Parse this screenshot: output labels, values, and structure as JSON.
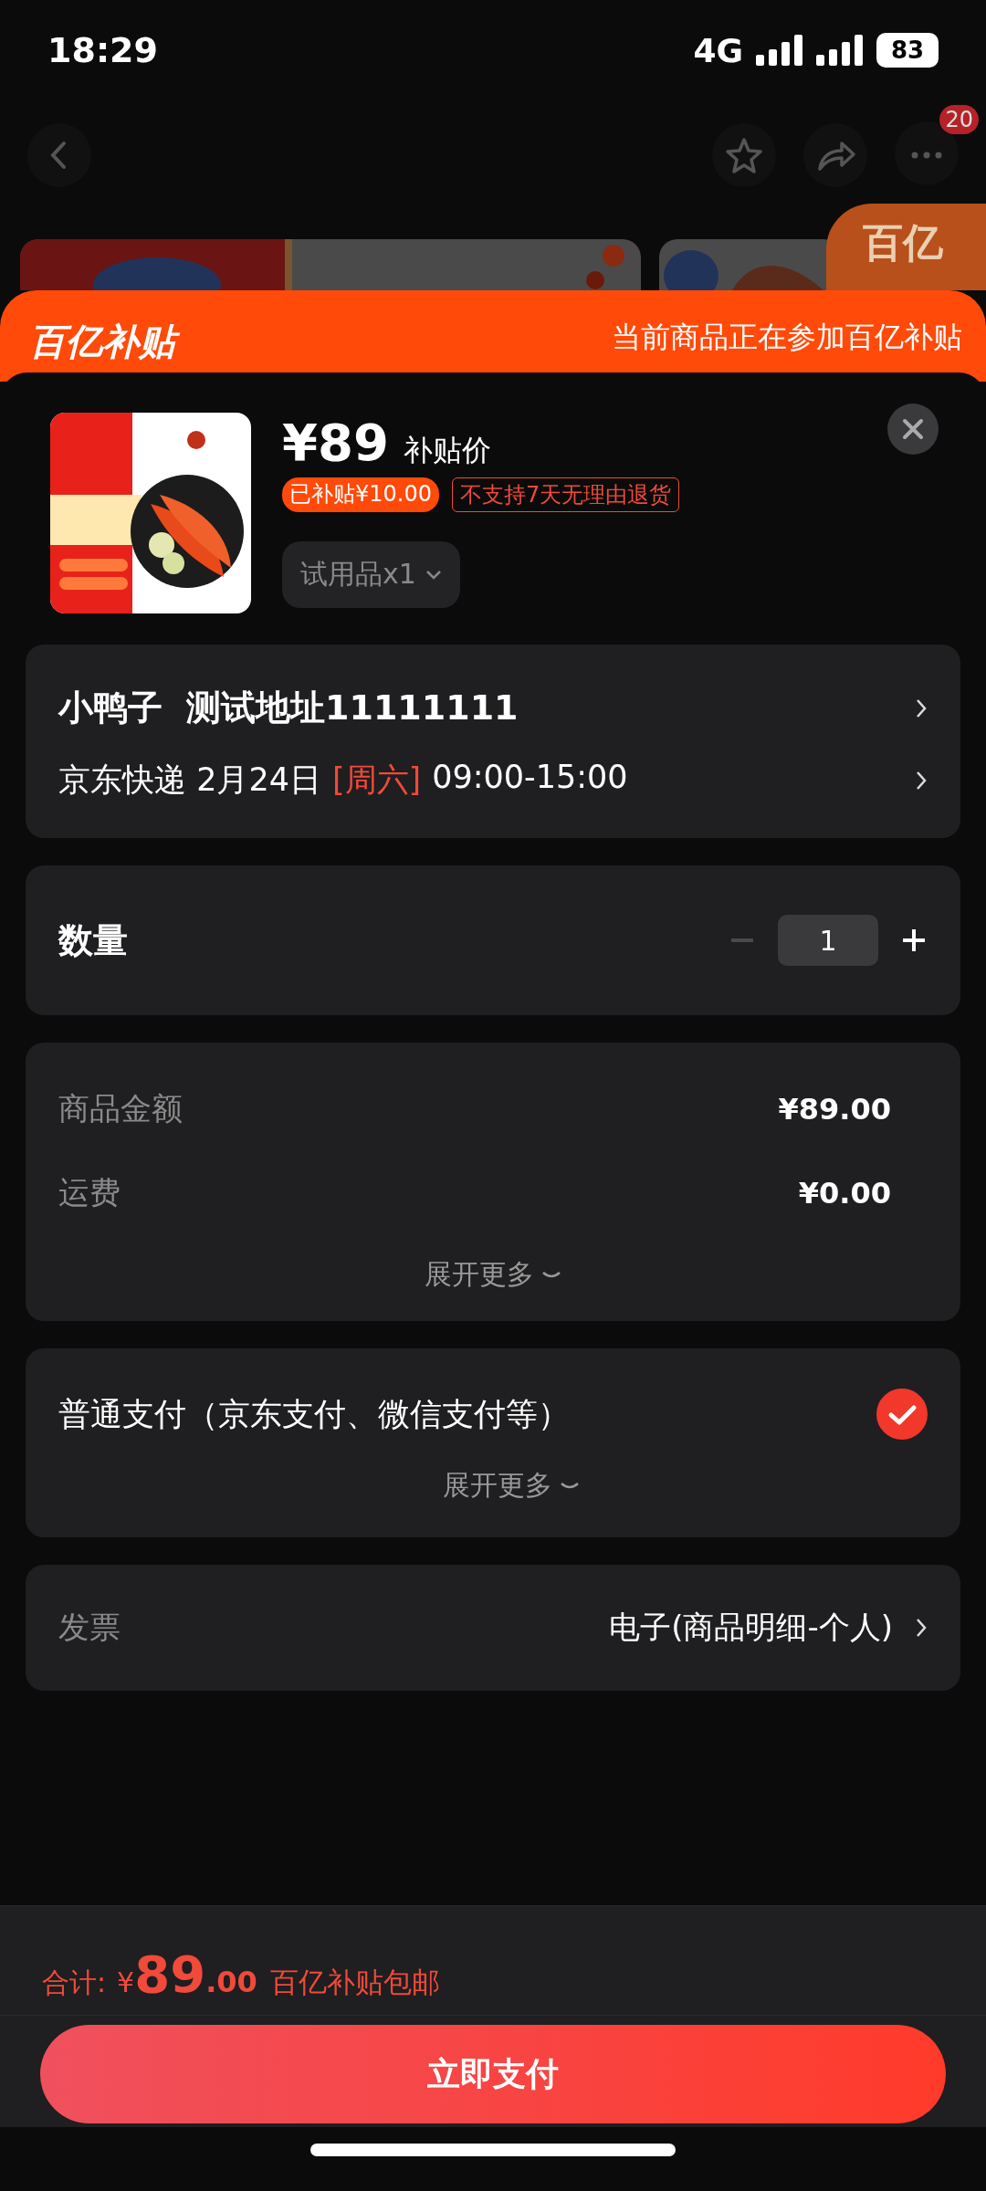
{
  "status_bar": {
    "time": "18:29",
    "network": "4G",
    "battery": "83"
  },
  "nav": {
    "badge": "20"
  },
  "background_badge": {
    "text": "百亿"
  },
  "banner": {
    "logo": "百亿补贴",
    "text": "当前商品正在参加百亿补贴"
  },
  "product": {
    "price": "¥89",
    "price_label": "补贴价",
    "tags": [
      {
        "kind": "filled",
        "text": "已补贴¥10.00"
      },
      {
        "kind": "outline",
        "text": "不支持7天无理由退货"
      }
    ],
    "spec": "试用品x1"
  },
  "address": {
    "name": "小鸭子",
    "address": "测试地址11111111",
    "shipping": "京东快递 2月24日",
    "weekday": "[周六]",
    "time": "09:00-15:00"
  },
  "quantity": {
    "label": "数量",
    "value": "1",
    "minus_disabled": true
  },
  "costs": {
    "rows": [
      {
        "label": "商品金额",
        "value": "¥89.00"
      },
      {
        "label": "运费",
        "value": "¥0.00"
      }
    ],
    "expand": "展开更多"
  },
  "payment": {
    "label": "普通支付（京东支付、微信支付等）",
    "checked": true,
    "expand": "展开更多"
  },
  "invoice": {
    "label": "发票",
    "value": "电子(商品明细-个人)"
  },
  "footer": {
    "total_label": "合计:",
    "currency": "¥",
    "integer": "89",
    "decimal": ".00",
    "note": "百亿补贴包邮",
    "pay_button": "立即支付"
  }
}
